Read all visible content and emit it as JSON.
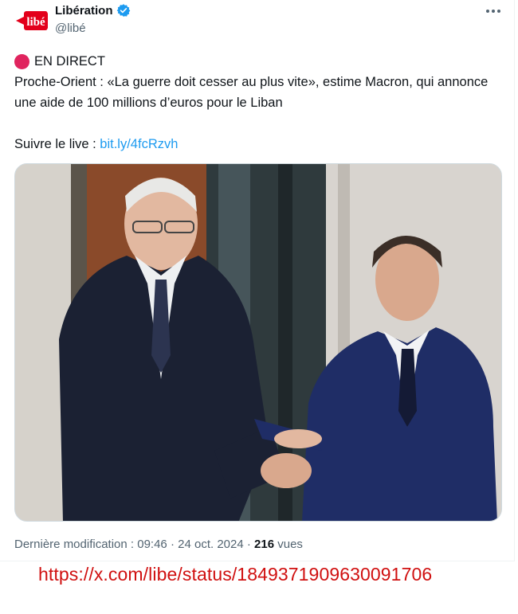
{
  "account": {
    "display_name": "Libération",
    "handle": "@libé",
    "logo_text": "libé",
    "verified_icon": "verified-badge-icon",
    "more_icon": "more-options-icon"
  },
  "tweet": {
    "live_label": "EN DIRECT",
    "headline": "Proche-Orient : «La guerre doit cesser au plus vite», estime Macron, qui annonce une aide de 100 millions d’euros pour le Liban",
    "follow_prefix": "Suivre le live : ",
    "follow_link": "bit.ly/4fcRzvh"
  },
  "footer": {
    "modified_label": "Dernière modification : ",
    "time": "09:46",
    "date": "24 oct. 2024",
    "separator": " · ",
    "views_count": "216",
    "views_label": " vues"
  },
  "source_url": "https://x.com/libe/status/1849371909630091706",
  "colors": {
    "link": "#1d9bf0",
    "live_dot": "#e0245e",
    "verified": "#1d9bf0",
    "url_overlay": "#d01010",
    "secondary_text": "#536471"
  }
}
